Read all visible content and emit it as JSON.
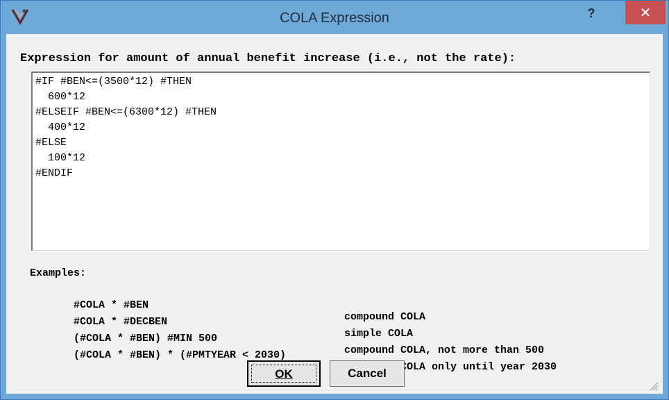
{
  "window": {
    "title": "COLA Expression",
    "help_label": "?",
    "close_label": "✕"
  },
  "prompt": "Expression for amount of annual benefit increase (i.e., not the rate):",
  "expression": "#IF #BEN<=(3500*12) #THEN\n  600*12\n#ELSEIF #BEN<=(6300*12) #THEN\n  400*12\n#ELSE\n  100*12\n#ENDIF",
  "examples": {
    "label": "Examples:",
    "rows": [
      {
        "expr": "#COLA * #BEN",
        "desc": "compound COLA"
      },
      {
        "expr": "#COLA * #DECBEN",
        "desc": "simple COLA"
      },
      {
        "expr": "(#COLA * #BEN) #MIN 500",
        "desc": "compound COLA, not more than 500"
      },
      {
        "expr": "(#COLA * #BEN) * (#PMTYEAR < 2030)",
        "desc": "compound COLA only until year 2030"
      }
    ]
  },
  "buttons": {
    "ok": "OK",
    "cancel": "Cancel"
  },
  "colors": {
    "frame": "#6fa9d8",
    "close": "#c75050",
    "client": "#f0f0f0"
  }
}
